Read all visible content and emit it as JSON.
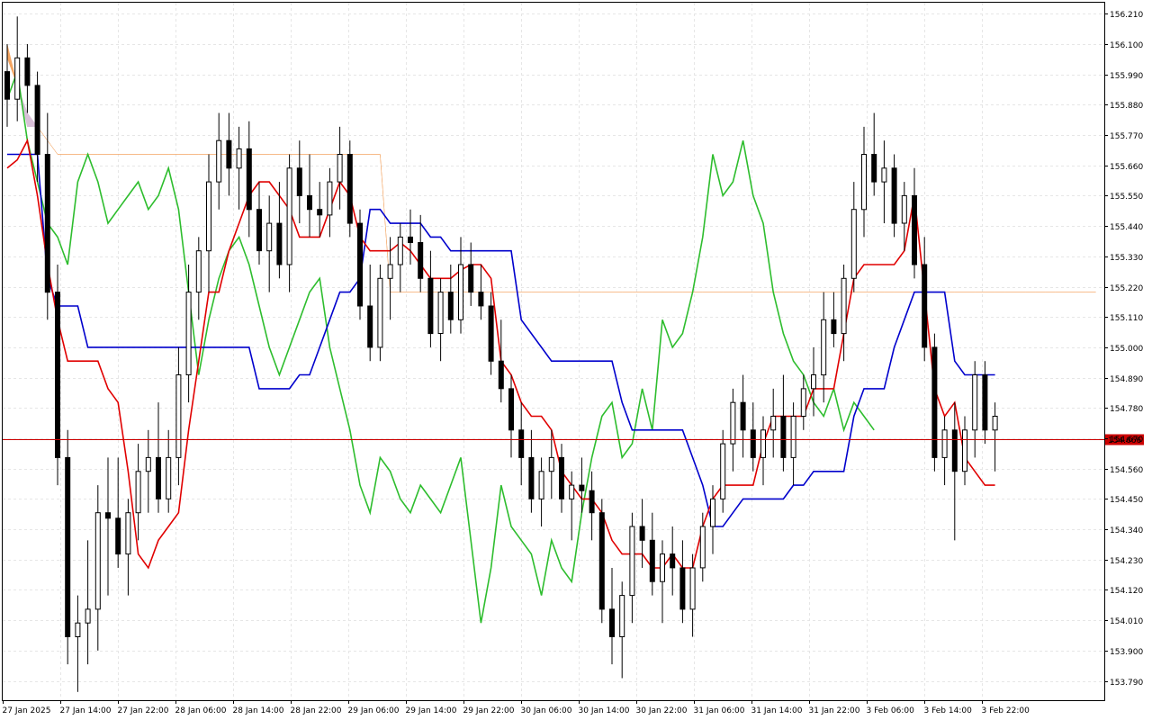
{
  "chart_data": {
    "type": "candlestick",
    "y_ticks": [
      "156.210",
      "156.100",
      "155.990",
      "155.880",
      "155.770",
      "155.660",
      "155.550",
      "155.440",
      "155.330",
      "155.220",
      "155.110",
      "155.000",
      "154.890",
      "154.780",
      "154.670",
      "154.560",
      "154.450",
      "154.340",
      "154.230",
      "154.120",
      "154.010",
      "153.900",
      "153.790"
    ],
    "ylim": [
      153.72,
      156.25
    ],
    "x_ticks": [
      "27 Jan 2025",
      "27 Jan 14:00",
      "27 Jan 22:00",
      "28 Jan 06:00",
      "28 Jan 14:00",
      "28 Jan 22:00",
      "29 Jan 06:00",
      "29 Jan 14:00",
      "29 Jan 22:00",
      "30 Jan 06:00",
      "30 Jan 14:00",
      "30 Jan 22:00",
      "31 Jan 06:00",
      "31 Jan 14:00",
      "31 Jan 22:00",
      "3 Feb 06:00",
      "3 Feb 14:00",
      "3 Feb 22:00"
    ],
    "current_price": "154.666",
    "colors": {
      "tenkan": "#e00000",
      "kijun": "#0000cc",
      "chikou": "#2ebd2e",
      "kumo_bull": "#f4a460",
      "kumo_bear": "#d8bfd8",
      "price_line": "#cc0000",
      "candle_bull": "#ffffff",
      "candle_bear": "#000000",
      "grid": "#e6e6e6"
    },
    "candles": [
      [
        156.0,
        156.1,
        155.8,
        155.9
      ],
      [
        155.9,
        156.2,
        155.82,
        156.05
      ],
      [
        156.05,
        156.1,
        155.85,
        155.95
      ],
      [
        155.95,
        156.0,
        155.6,
        155.7
      ],
      [
        155.7,
        155.85,
        155.1,
        155.2
      ],
      [
        155.2,
        155.3,
        154.5,
        154.6
      ],
      [
        154.6,
        154.7,
        153.85,
        153.95
      ],
      [
        153.95,
        154.1,
        153.75,
        154.0
      ],
      [
        154.0,
        154.3,
        153.85,
        154.05
      ],
      [
        154.05,
        154.5,
        153.9,
        154.4
      ],
      [
        154.4,
        154.6,
        154.1,
        154.38
      ],
      [
        154.38,
        154.6,
        154.2,
        154.25
      ],
      [
        154.25,
        154.45,
        154.1,
        154.4
      ],
      [
        154.4,
        154.65,
        154.3,
        154.55
      ],
      [
        154.55,
        154.7,
        154.4,
        154.6
      ],
      [
        154.6,
        154.8,
        154.4,
        154.45
      ],
      [
        154.45,
        154.7,
        154.4,
        154.6
      ],
      [
        154.6,
        155.0,
        154.5,
        154.9
      ],
      [
        154.9,
        155.3,
        154.8,
        155.2
      ],
      [
        155.2,
        155.4,
        155.1,
        155.35
      ],
      [
        155.35,
        155.7,
        155.2,
        155.6
      ],
      [
        155.6,
        155.85,
        155.5,
        155.75
      ],
      [
        155.75,
        155.85,
        155.55,
        155.65
      ],
      [
        155.65,
        155.8,
        155.5,
        155.72
      ],
      [
        155.72,
        155.82,
        155.4,
        155.5
      ],
      [
        155.5,
        155.6,
        155.3,
        155.35
      ],
      [
        155.35,
        155.55,
        155.2,
        155.45
      ],
      [
        155.45,
        155.6,
        155.25,
        155.3
      ],
      [
        155.3,
        155.7,
        155.2,
        155.65
      ],
      [
        155.65,
        155.75,
        155.45,
        155.55
      ],
      [
        155.55,
        155.7,
        155.4,
        155.5
      ],
      [
        155.5,
        155.6,
        155.4,
        155.48
      ],
      [
        155.48,
        155.65,
        155.4,
        155.6
      ],
      [
        155.6,
        155.8,
        155.5,
        155.7
      ],
      [
        155.7,
        155.75,
        155.4,
        155.45
      ],
      [
        155.45,
        155.5,
        155.1,
        155.15
      ],
      [
        155.15,
        155.3,
        154.95,
        155.0
      ],
      [
        155.0,
        155.3,
        154.95,
        155.25
      ],
      [
        155.25,
        155.4,
        155.1,
        155.3
      ],
      [
        155.3,
        155.45,
        155.2,
        155.4
      ],
      [
        155.4,
        155.5,
        155.3,
        155.38
      ],
      [
        155.38,
        155.48,
        155.2,
        155.25
      ],
      [
        155.25,
        155.35,
        155.0,
        155.05
      ],
      [
        155.05,
        155.25,
        154.95,
        155.2
      ],
      [
        155.2,
        155.3,
        155.05,
        155.1
      ],
      [
        155.1,
        155.4,
        155.05,
        155.3
      ],
      [
        155.3,
        155.38,
        155.15,
        155.2
      ],
      [
        155.2,
        155.3,
        155.1,
        155.15
      ],
      [
        155.15,
        155.2,
        154.9,
        154.95
      ],
      [
        154.95,
        155.1,
        154.8,
        154.85
      ],
      [
        154.85,
        154.9,
        154.6,
        154.7
      ],
      [
        154.7,
        154.8,
        154.5,
        154.6
      ],
      [
        154.6,
        154.7,
        154.4,
        154.45
      ],
      [
        154.45,
        154.6,
        154.35,
        154.55
      ],
      [
        154.55,
        154.7,
        154.45,
        154.6
      ],
      [
        154.6,
        154.65,
        154.4,
        154.45
      ],
      [
        154.45,
        154.55,
        154.3,
        154.5
      ],
      [
        154.5,
        154.6,
        154.4,
        154.48
      ],
      [
        154.48,
        154.55,
        154.3,
        154.4
      ],
      [
        154.4,
        154.45,
        154.0,
        154.05
      ],
      [
        154.05,
        154.2,
        153.85,
        153.95
      ],
      [
        153.95,
        154.15,
        153.8,
        154.1
      ],
      [
        154.1,
        154.4,
        154.0,
        154.35
      ],
      [
        154.35,
        154.45,
        154.2,
        154.3
      ],
      [
        154.3,
        154.4,
        154.1,
        154.15
      ],
      [
        154.15,
        154.3,
        154.0,
        154.25
      ],
      [
        154.25,
        154.35,
        154.1,
        154.2
      ],
      [
        154.2,
        154.3,
        154.0,
        154.05
      ],
      [
        154.05,
        154.25,
        153.95,
        154.2
      ],
      [
        154.2,
        154.4,
        154.15,
        154.35
      ],
      [
        154.35,
        154.5,
        154.25,
        154.45
      ],
      [
        154.45,
        154.7,
        154.4,
        154.65
      ],
      [
        154.65,
        154.85,
        154.55,
        154.8
      ],
      [
        154.8,
        154.9,
        154.6,
        154.7
      ],
      [
        154.7,
        154.8,
        154.55,
        154.6
      ],
      [
        154.6,
        154.75,
        154.5,
        154.7
      ],
      [
        154.7,
        154.85,
        154.6,
        154.75
      ],
      [
        154.75,
        154.9,
        154.55,
        154.6
      ],
      [
        154.6,
        154.8,
        154.5,
        154.75
      ],
      [
        154.75,
        154.9,
        154.7,
        154.85
      ],
      [
        154.85,
        155.0,
        154.75,
        154.9
      ],
      [
        154.9,
        155.2,
        154.8,
        155.1
      ],
      [
        155.1,
        155.2,
        155.0,
        155.05
      ],
      [
        155.05,
        155.3,
        154.95,
        155.25
      ],
      [
        155.25,
        155.6,
        155.2,
        155.5
      ],
      [
        155.5,
        155.8,
        155.4,
        155.7
      ],
      [
        155.7,
        155.85,
        155.55,
        155.6
      ],
      [
        155.6,
        155.75,
        155.45,
        155.65
      ],
      [
        155.65,
        155.7,
        155.4,
        155.45
      ],
      [
        155.45,
        155.6,
        155.35,
        155.55
      ],
      [
        155.55,
        155.65,
        155.25,
        155.3
      ],
      [
        155.3,
        155.4,
        154.95,
        155.0
      ],
      [
        155.0,
        155.05,
        154.55,
        154.6
      ],
      [
        154.6,
        154.75,
        154.5,
        154.7
      ],
      [
        154.7,
        154.8,
        154.3,
        154.55
      ],
      [
        154.55,
        154.75,
        154.5,
        154.7
      ],
      [
        154.7,
        154.95,
        154.6,
        154.9
      ],
      [
        154.9,
        154.95,
        154.65,
        154.7
      ],
      [
        154.7,
        154.8,
        154.55,
        154.75
      ]
    ],
    "tenkan": [
      155.65,
      155.68,
      155.75,
      155.55,
      155.3,
      155.1,
      154.95,
      154.95,
      154.95,
      154.95,
      154.85,
      154.8,
      154.55,
      154.25,
      154.2,
      154.3,
      154.35,
      154.4,
      154.7,
      154.95,
      155.2,
      155.2,
      155.35,
      155.45,
      155.55,
      155.6,
      155.6,
      155.55,
      155.5,
      155.4,
      155.4,
      155.4,
      155.5,
      155.6,
      155.55,
      155.4,
      155.35,
      155.35,
      155.35,
      155.38,
      155.35,
      155.3,
      155.25,
      155.25,
      155.25,
      155.28,
      155.3,
      155.3,
      155.25,
      154.95,
      154.9,
      154.8,
      154.75,
      154.75,
      154.7,
      154.55,
      154.5,
      154.45,
      154.45,
      154.4,
      154.3,
      154.25,
      154.25,
      154.25,
      154.2,
      154.2,
      154.25,
      154.2,
      154.2,
      154.35,
      154.45,
      154.5,
      154.5,
      154.5,
      154.5,
      154.65,
      154.75,
      154.75,
      154.75,
      154.75,
      154.85,
      154.85,
      154.85,
      155.05,
      155.25,
      155.3,
      155.3,
      155.3,
      155.3,
      155.35,
      155.55,
      155.2,
      154.85,
      154.75,
      154.8,
      154.6,
      154.55,
      154.5,
      154.5
    ],
    "kijun": [
      155.7,
      155.7,
      155.7,
      155.7,
      155.25,
      155.15,
      155.15,
      155.15,
      155.0,
      155.0,
      155.0,
      155.0,
      155.0,
      155.0,
      155.0,
      155.0,
      155.0,
      155.0,
      155.0,
      155.0,
      155.0,
      155.0,
      155.0,
      155.0,
      155.0,
      154.85,
      154.85,
      154.85,
      154.85,
      154.9,
      154.9,
      155.0,
      155.1,
      155.2,
      155.2,
      155.25,
      155.5,
      155.5,
      155.45,
      155.45,
      155.45,
      155.45,
      155.4,
      155.4,
      155.35,
      155.35,
      155.35,
      155.35,
      155.35,
      155.35,
      155.35,
      155.1,
      155.05,
      155.0,
      154.95,
      154.95,
      154.95,
      154.95,
      154.95,
      154.95,
      154.95,
      154.8,
      154.7,
      154.7,
      154.7,
      154.7,
      154.7,
      154.7,
      154.6,
      154.5,
      154.35,
      154.35,
      154.4,
      154.45,
      154.45,
      154.45,
      154.45,
      154.45,
      154.5,
      154.5,
      154.55,
      154.55,
      154.55,
      154.55,
      154.75,
      154.85,
      154.85,
      154.85,
      155.0,
      155.1,
      155.2,
      155.2,
      155.2,
      155.2,
      154.95,
      154.9,
      154.9,
      154.9,
      154.9
    ],
    "chikou": [
      155.9,
      156.0,
      155.75,
      155.6,
      155.45,
      155.4,
      155.3,
      155.6,
      155.7,
      155.6,
      155.45,
      155.5,
      155.55,
      155.6,
      155.5,
      155.55,
      155.65,
      155.5,
      155.2,
      154.9,
      155.1,
      155.25,
      155.35,
      155.4,
      155.3,
      155.15,
      155.0,
      154.9,
      155.0,
      155.1,
      155.2,
      155.25,
      155.0,
      154.85,
      154.7,
      154.5,
      154.4,
      154.6,
      154.55,
      154.45,
      154.4,
      154.5,
      154.45,
      154.4,
      154.5,
      154.6,
      154.3,
      154.0,
      154.2,
      154.5,
      154.35,
      154.3,
      154.25,
      154.1,
      154.3,
      154.2,
      154.15,
      154.4,
      154.6,
      154.75,
      154.8,
      154.6,
      154.65,
      154.85,
      154.7,
      155.1,
      155.0,
      155.05,
      155.2,
      155.4,
      155.7,
      155.55,
      155.6,
      155.75,
      155.55,
      155.45,
      155.2,
      155.05,
      154.95,
      154.9,
      154.8,
      154.75,
      154.85,
      154.7,
      154.8,
      154.75,
      154.7
    ],
    "senkou_a": [
      156.1,
      155.95,
      155.8,
      155.8,
      155.75,
      155.7,
      155.7,
      155.7,
      155.7,
      155.7,
      155.7,
      155.7,
      155.7,
      155.7,
      155.7,
      155.7,
      155.7,
      155.7,
      155.7,
      155.7,
      155.7,
      155.7,
      155.7,
      155.7,
      155.7,
      155.7,
      155.7,
      155.7,
      155.7,
      155.7,
      155.7,
      155.7,
      155.7,
      155.7,
      155.7,
      155.7,
      155.7,
      155.7,
      155.2,
      155.2,
      155.2,
      155.2,
      155.2,
      155.2,
      155.2,
      155.2,
      155.2,
      155.2,
      155.2,
      155.2,
      155.2,
      155.2,
      155.2,
      155.2,
      155.2,
      155.2,
      155.2,
      155.2,
      155.2,
      155.2,
      155.2,
      155.2,
      155.2,
      155.2,
      155.2,
      155.2,
      155.2,
      155.2,
      155.2,
      155.2,
      155.2,
      155.2,
      155.2,
      155.2,
      155.2,
      155.2,
      155.2,
      155.2,
      155.2,
      155.2,
      155.2,
      155.2,
      155.2,
      155.2,
      155.2,
      155.2,
      155.2,
      155.2,
      155.2,
      155.2,
      155.2,
      155.2,
      155.2,
      155.2,
      155.2,
      155.2,
      155.2,
      155.2,
      155.2,
      155.2,
      155.2,
      155.2,
      155.2,
      155.2,
      155.2,
      155.2,
      155.2,
      155.2,
      155.2,
      155.2,
      155.2,
      155.2,
      155.2,
      155.2,
      155.2,
      155.2
    ],
    "senkou_b": [
      156.05,
      155.95,
      155.85,
      155.8,
      155.75,
      155.7,
      155.7,
      155.7,
      155.7,
      155.7,
      155.7,
      155.7,
      155.7,
      155.7,
      155.7,
      155.7,
      155.7,
      155.7,
      155.7,
      155.7,
      155.7,
      155.7,
      155.7,
      155.7,
      155.7,
      155.7,
      155.7,
      155.7,
      155.7,
      155.7,
      155.7,
      155.7,
      155.7,
      155.7,
      155.7,
      155.7,
      155.7,
      155.7,
      155.2,
      155.2,
      155.2,
      155.2,
      155.2,
      155.2,
      155.2,
      155.2,
      155.2,
      155.2,
      155.2,
      155.2,
      155.2,
      155.2,
      155.2,
      155.2,
      155.2,
      155.2,
      155.2,
      155.2,
      155.2,
      155.2,
      155.2,
      155.2,
      155.2,
      155.2,
      155.2,
      155.2,
      155.2,
      155.2,
      155.2,
      155.2,
      155.2,
      155.2,
      155.2,
      155.2,
      155.2,
      155.2,
      155.2,
      155.2,
      155.2,
      155.2,
      155.2,
      155.2,
      155.2,
      155.2,
      155.2,
      155.2,
      155.2,
      155.2,
      155.2,
      155.2,
      155.2,
      155.2,
      155.2,
      155.2,
      155.2,
      155.2,
      155.2,
      155.2,
      155.2,
      155.2,
      155.2,
      155.2,
      155.2,
      155.2,
      155.2,
      155.2,
      155.2,
      155.2,
      155.2,
      155.2,
      155.2,
      155.2,
      155.2,
      155.2,
      155.2,
      155.2
    ]
  }
}
